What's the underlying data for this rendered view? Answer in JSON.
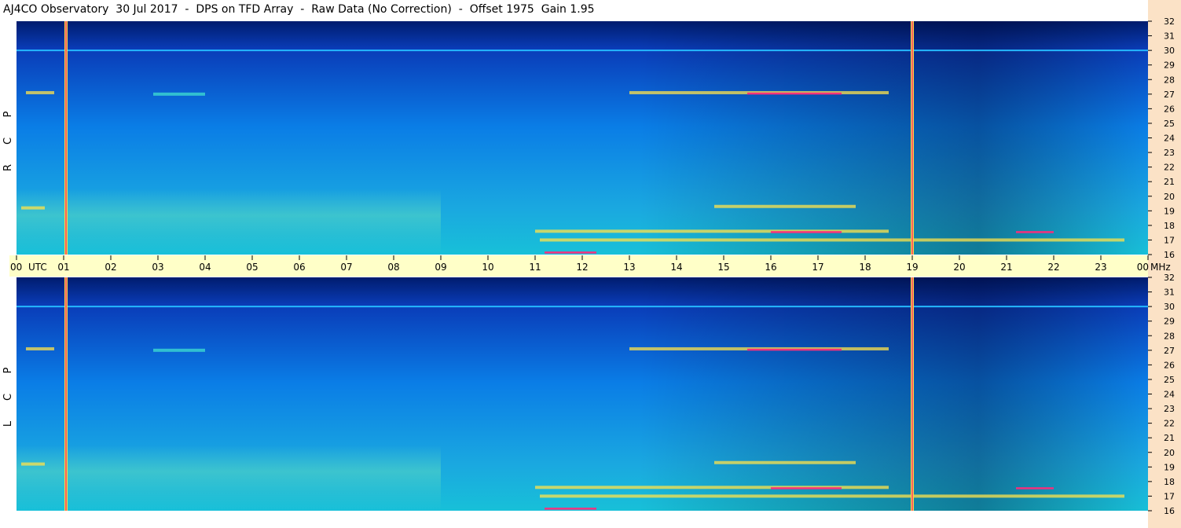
{
  "title": "AJ4CO Observatory  30 Jul 2017  -  DPS on TFD Array  -  Raw Data (No Correction)  -  Offset 1975  Gain 1.95",
  "chart_data": {
    "type": "heatmap",
    "x_unit_label": "UTC",
    "y_unit_label": "MHz",
    "x_ticks": [
      "00",
      "01",
      "02",
      "03",
      "04",
      "05",
      "06",
      "07",
      "08",
      "09",
      "10",
      "11",
      "12",
      "13",
      "14",
      "15",
      "16",
      "17",
      "18",
      "19",
      "20",
      "21",
      "22",
      "23",
      "00"
    ],
    "xlim_hours": [
      0,
      24
    ],
    "y_ticks": [
      "32",
      "31",
      "30",
      "29",
      "28",
      "27",
      "26",
      "25",
      "24",
      "23",
      "22",
      "21",
      "20",
      "19",
      "18",
      "17",
      "16"
    ],
    "ylim_mhz": [
      16,
      32
    ],
    "colors": {
      "low": "#001c6e",
      "mid": "#0a7de6",
      "high": "#3fe0d0",
      "peak": "#ffe34a",
      "max": "#ff2a7a"
    },
    "panels": [
      {
        "name": "RCP",
        "side_label": [
          "R",
          "C",
          "P"
        ],
        "vertical_markers_utc": [
          1.05,
          19.0
        ],
        "horizontal_lines_mhz": [
          30.0
        ],
        "bright_features": [
          {
            "start_utc": 0.2,
            "end_utc": 0.8,
            "mhz": 27.1,
            "level": "peak"
          },
          {
            "start_utc": 2.9,
            "end_utc": 4.0,
            "mhz": 27.0,
            "level": "high"
          },
          {
            "start_utc": 13.0,
            "end_utc": 18.5,
            "mhz": 27.1,
            "level": "peak"
          },
          {
            "start_utc": 15.5,
            "end_utc": 17.5,
            "mhz": 27.0,
            "level": "max"
          },
          {
            "start_utc": 11.0,
            "end_utc": 18.5,
            "mhz": 17.6,
            "level": "peak"
          },
          {
            "start_utc": 16.0,
            "end_utc": 17.5,
            "mhz": 17.5,
            "level": "max"
          },
          {
            "start_utc": 11.1,
            "end_utc": 23.5,
            "mhz": 17.0,
            "level": "peak"
          },
          {
            "start_utc": 21.2,
            "end_utc": 22.0,
            "mhz": 17.5,
            "level": "max"
          },
          {
            "start_utc": 11.2,
            "end_utc": 12.3,
            "mhz": 16.1,
            "level": "max"
          },
          {
            "start_utc": 14.8,
            "end_utc": 17.8,
            "mhz": 19.3,
            "level": "peak"
          },
          {
            "start_utc": 0.1,
            "end_utc": 0.6,
            "mhz": 19.2,
            "level": "peak"
          }
        ]
      },
      {
        "name": "LCP",
        "side_label": [
          "L",
          "C",
          "P"
        ],
        "vertical_markers_utc": [
          1.05,
          19.0
        ],
        "horizontal_lines_mhz": [
          30.0
        ],
        "bright_features": [
          {
            "start_utc": 0.2,
            "end_utc": 0.8,
            "mhz": 27.1,
            "level": "peak"
          },
          {
            "start_utc": 2.9,
            "end_utc": 4.0,
            "mhz": 27.0,
            "level": "high"
          },
          {
            "start_utc": 13.0,
            "end_utc": 18.5,
            "mhz": 27.1,
            "level": "peak"
          },
          {
            "start_utc": 15.5,
            "end_utc": 17.5,
            "mhz": 27.0,
            "level": "max"
          },
          {
            "start_utc": 11.0,
            "end_utc": 18.5,
            "mhz": 17.6,
            "level": "peak"
          },
          {
            "start_utc": 16.0,
            "end_utc": 17.5,
            "mhz": 17.5,
            "level": "max"
          },
          {
            "start_utc": 11.1,
            "end_utc": 23.5,
            "mhz": 17.0,
            "level": "peak"
          },
          {
            "start_utc": 21.2,
            "end_utc": 22.0,
            "mhz": 17.5,
            "level": "max"
          },
          {
            "start_utc": 11.2,
            "end_utc": 12.3,
            "mhz": 16.1,
            "level": "max"
          },
          {
            "start_utc": 14.8,
            "end_utc": 17.8,
            "mhz": 19.3,
            "level": "peak"
          },
          {
            "start_utc": 0.1,
            "end_utc": 0.6,
            "mhz": 19.2,
            "level": "peak"
          }
        ]
      }
    ]
  }
}
